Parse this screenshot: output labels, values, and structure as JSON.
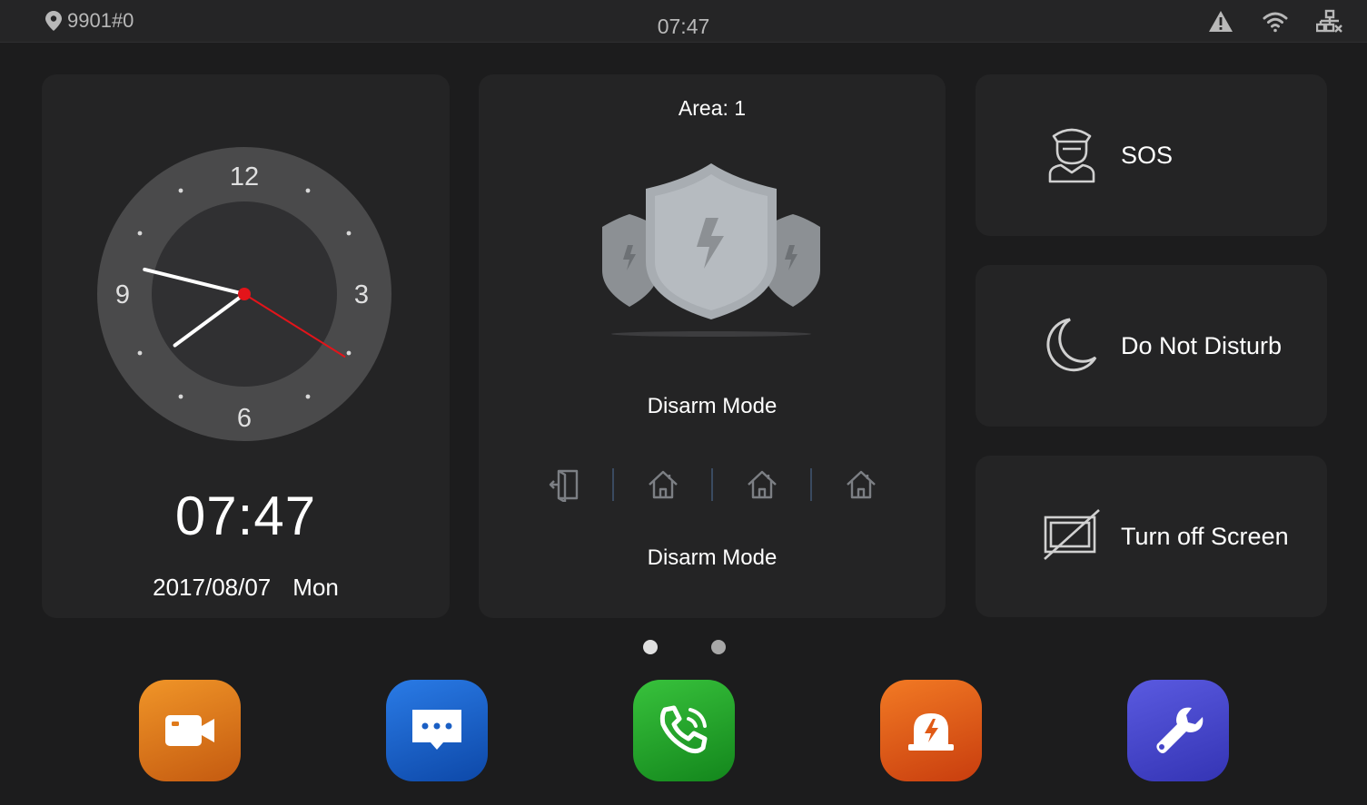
{
  "status_bar": {
    "location": "9901#0",
    "time": "07:47",
    "icons": [
      "location-pin-icon",
      "alert-triangle-icon",
      "wifi-icon",
      "network-disconnected-icon"
    ]
  },
  "clock_widget": {
    "numerals": [
      "12",
      "3",
      "6",
      "9"
    ],
    "time": "07:47",
    "date": "2017/08/07",
    "weekday": "Mon",
    "analog": {
      "hour": 7,
      "minute": 47,
      "second": 19
    }
  },
  "arming_widget": {
    "area_label": "Area: 1",
    "status_icon": "shield-group-icon",
    "current_mode": "Disarm Mode",
    "mode_icons": [
      "disarm-door-icon",
      "home-mode-icon",
      "away-mode-icon",
      "sleep-mode-icon"
    ],
    "selected_mode_label": "Disarm Mode"
  },
  "actions": [
    {
      "label": "SOS",
      "icon": "security-guard-icon"
    },
    {
      "label": "Do Not Disturb",
      "icon": "moon-icon"
    },
    {
      "label": "Turn off Screen",
      "icon": "screen-off-icon"
    }
  ],
  "pager": {
    "count": 2,
    "active_index": 0
  },
  "dock": [
    {
      "app": "monitor",
      "icon": "video-camera-icon",
      "color": "#d9711a"
    },
    {
      "app": "message",
      "icon": "message-bubble-icon",
      "color": "#1a5fc4"
    },
    {
      "app": "call",
      "icon": "phone-icon",
      "color": "#25a32a"
    },
    {
      "app": "alarm",
      "icon": "alarm-siren-icon",
      "color": "#e05a16"
    },
    {
      "app": "settings",
      "icon": "wrench-icon",
      "color": "#4646c8"
    }
  ],
  "colors": {
    "background": "#1c1c1d",
    "card": "#242425",
    "second_hand": "#e3141a",
    "muted_text": "#b8b8b8"
  }
}
